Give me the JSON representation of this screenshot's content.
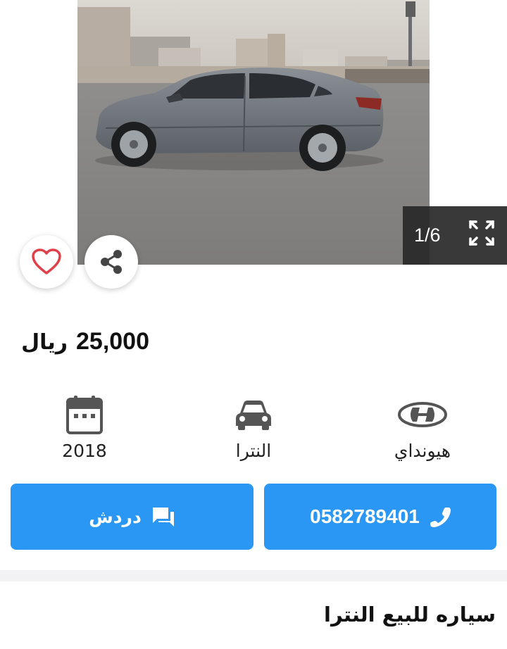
{
  "gallery": {
    "counter": "1/6",
    "prev_icon": "chevron-left-icon",
    "next_icon": "chevron-right-icon",
    "expand_icon": "expand-icon"
  },
  "actions_round": {
    "favorite_icon": "heart-outline-icon",
    "share_icon": "share-icon"
  },
  "price": {
    "amount": "25,000",
    "currency": "ريال"
  },
  "specs": {
    "make": "هيونداي",
    "model": "النترا",
    "year": "2018"
  },
  "buttons": {
    "call_number": "0582789401",
    "chat_label": "دردش"
  },
  "listing": {
    "title": "سياره للبيع النترا"
  },
  "colors": {
    "accent": "#2b97f5",
    "favorite": "#e0404a"
  }
}
